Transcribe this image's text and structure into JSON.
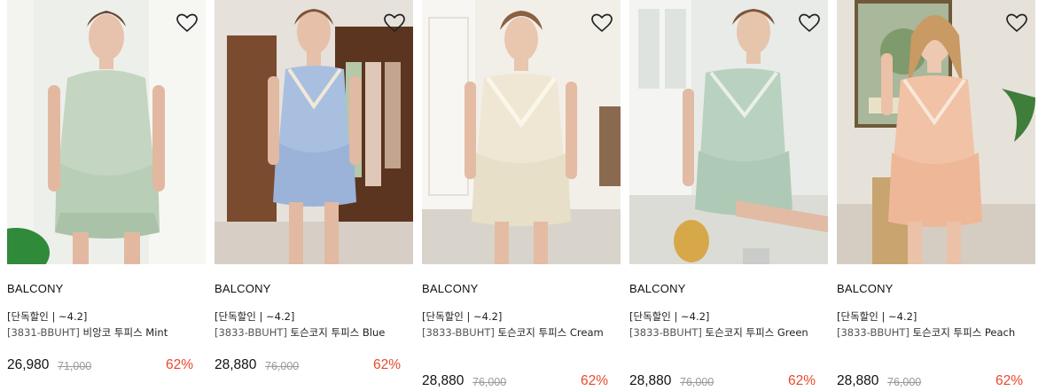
{
  "colors": {
    "discount": "#e8482c",
    "original_price": "#9a9a9a",
    "text": "#222222"
  },
  "products": [
    {
      "brand": "BALCONY",
      "promo": "[단독할인 | ~4.2]",
      "code": "[3831-BBUHT]",
      "name": "비앙코 투피스 Mint",
      "price": "26,980",
      "original_price": "71,000",
      "discount": "62%",
      "wishlist_icon": "heart-outline-icon",
      "image_main_color": "#c4d6c2"
    },
    {
      "brand": "BALCONY",
      "promo": "[단독할인 | ~4.2]",
      "code": "[3833-BBUHT]",
      "name": "토슨코지 투피스 Blue",
      "price": "28,880",
      "original_price": "76,000",
      "discount": "62%",
      "wishlist_icon": "heart-outline-icon",
      "image_main_color": "#a9bfe0"
    },
    {
      "brand": "BALCONY",
      "promo": "[단독할인 | ~4.2]",
      "code": "[3833-BBUHT]",
      "name": "토슨코지 투피스 Cream",
      "price": "28,880",
      "original_price": "76,000",
      "discount": "62%",
      "wishlist_icon": "heart-outline-icon",
      "image_main_color": "#efe7d3"
    },
    {
      "brand": "BALCONY",
      "promo": "[단독할인 | ~4.2]",
      "code": "[3833-BBUHT]",
      "name": "토슨코지 투피스 Green",
      "price": "28,880",
      "original_price": "76,000",
      "discount": "62%",
      "wishlist_icon": "heart-outline-icon",
      "image_main_color": "#b9d2c0"
    },
    {
      "brand": "BALCONY",
      "promo": "[단독할인 | ~4.2]",
      "code": "[3833-BBUHT]",
      "name": "토슨코지 투피스 Peach",
      "price": "28,880",
      "original_price": "76,000",
      "discount": "62%",
      "wishlist_icon": "heart-outline-icon",
      "image_main_color": "#f1c2a5"
    }
  ]
}
